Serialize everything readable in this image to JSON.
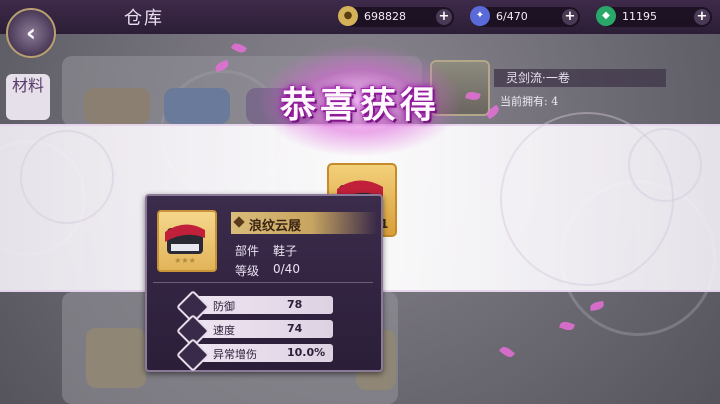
{
  "topbar": {
    "title": "仓库",
    "resources": [
      {
        "icon": "coin-icon",
        "value": "698828"
      },
      {
        "icon": "stamina-icon",
        "value": "6/470"
      },
      {
        "icon": "jade-icon",
        "value": "11195"
      }
    ],
    "plus_label": "+"
  },
  "side_tab": {
    "label": "材料"
  },
  "detail": {
    "name": "灵剑流·一卷",
    "owned": "当前拥有: 4"
  },
  "reward": {
    "title": "恭喜获得",
    "item_count": "1"
  },
  "tooltip": {
    "name": "浪纹云屐",
    "part_label": "部件",
    "part_value": "鞋子",
    "level_label": "等级",
    "level_value": "0/40",
    "stats": [
      {
        "label": "防御",
        "value": "78",
        "icon": "defense-icon"
      },
      {
        "label": "速度",
        "value": "74",
        "icon": "speed-icon"
      },
      {
        "label": "异常增伤",
        "value": "10.0%",
        "icon": "status-damage-icon"
      }
    ]
  },
  "colors": {
    "accent_purple": "#8a1a9a",
    "gold": "#d9bc7a",
    "panel": "#3c2c4c"
  }
}
